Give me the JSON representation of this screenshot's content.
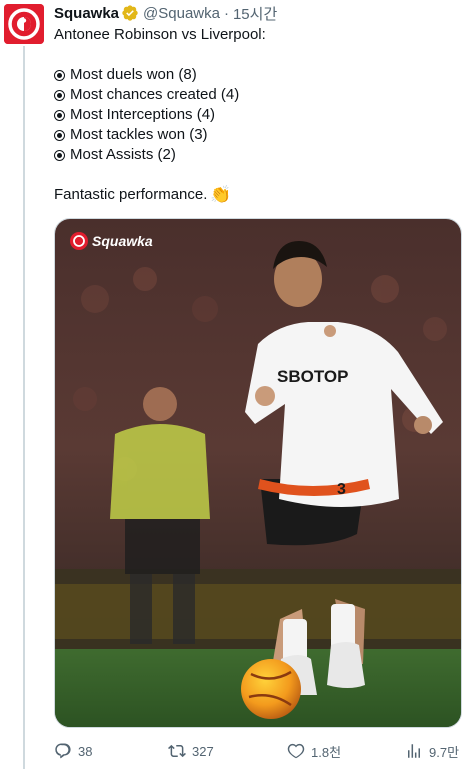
{
  "tweet": {
    "author": {
      "display_name": "Squawka",
      "handle": "@Squawka",
      "verified": true,
      "avatar_icon": "squawka-logo"
    },
    "separator": "·",
    "time": "15시간",
    "text_lines": {
      "intro": "Antonee Robinson vs Liverpool:",
      "stat1": "Most duels won (8)",
      "stat2": "Most chances created (4)",
      "stat3": "Most Interceptions (4)",
      "stat4": "Most tackles won (3)",
      "stat5": "Most Assists (2)",
      "outro": "Fantastic performance."
    },
    "emoji": "clapping-hands",
    "media": {
      "watermark": "Squawka",
      "shirt_sponsor": "SBOTOP",
      "shirt_number": "3"
    },
    "actions": {
      "replies": "38",
      "reposts": "327",
      "likes": "1.8천",
      "views": "9.7만"
    }
  },
  "colors": {
    "brand_red": "#e11d2e",
    "verified_gold": "#e2b719",
    "muted_text": "#536471"
  }
}
